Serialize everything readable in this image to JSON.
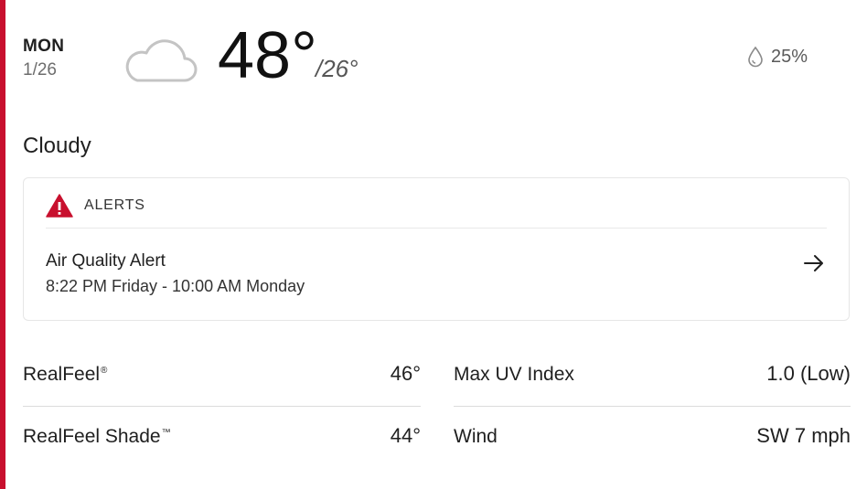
{
  "day": {
    "dow": "MON",
    "date": "1/26"
  },
  "icon": "cloud-icon",
  "temperature": {
    "high": "48°",
    "low": "/26°"
  },
  "precipitation": {
    "icon": "raindrop-icon",
    "value": "25%"
  },
  "phrase": "Cloudy",
  "alerts": {
    "header": "ALERTS",
    "icon": "warning-triangle-icon",
    "title": "Air Quality Alert",
    "time": "8:22 PM Friday - 10:00 AM Monday"
  },
  "details": {
    "realfeel": {
      "label": "RealFeel",
      "mark": "®",
      "value": "46°"
    },
    "realfeel_shade": {
      "label": "RealFeel Shade",
      "mark": "™",
      "value": "44°"
    },
    "max_uv": {
      "label": "Max UV Index",
      "value": "1.0 (Low)"
    },
    "wind": {
      "label": "Wind",
      "value": "SW 7 mph"
    }
  },
  "colors": {
    "accent": "#c8102e",
    "alert_icon": "#c8102e"
  }
}
